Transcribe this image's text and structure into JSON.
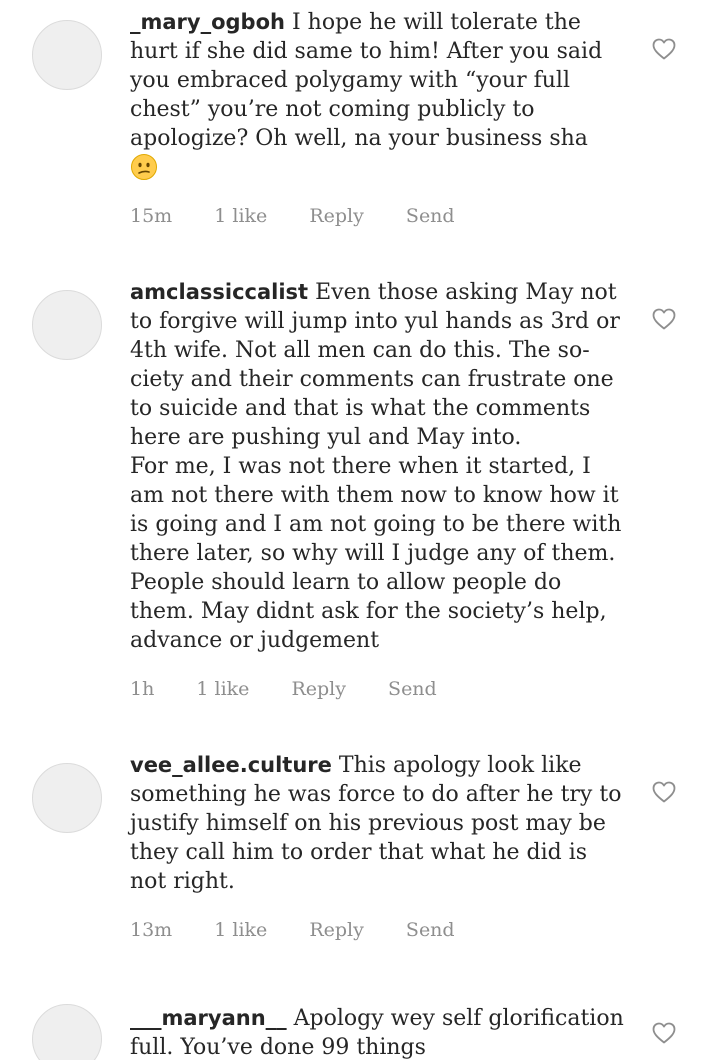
{
  "comments": [
    {
      "username": "_mary_ogboh",
      "text": "I hope he will tolerate the hurt if she did same to him! After you said you embraced polygamy with “your full chest” you’re not coming publicly to apologize? Oh well, na your business sha",
      "emoji": "confused-face-emoji",
      "time": "15m",
      "likes": "1 like",
      "reply_label": "Reply",
      "send_label": "Send"
    },
    {
      "username": "amclassiccalist",
      "text": "Even those asking May not to forgive will jump into yul hands as 3rd or 4th wife. Not all men can do this. The so-ciety and their comments can frustrate one to suicide and that is what the comments here are pushing yul and May into.",
      "text2": "For me, I was not there when it started, I am not there with them now to know how it is going and I am not going to be there with there later, so why will I judge any of them. People should learn to allow people do them. May didnt ask for the society’s help, advance or judgement",
      "time": "1h",
      "likes": "1 like",
      "reply_label": "Reply",
      "send_label": "Send"
    },
    {
      "username": "vee_allee.culture",
      "text": "This apology look like something he was force to do after he try to justify himself on his previous post may be they call him to order that what he did is not right.",
      "time": "13m",
      "likes": "1 like",
      "reply_label": "Reply",
      "send_label": "Send"
    },
    {
      "username": "___maryann__",
      "text": "Apology wey self glorification full. You’ve done 99 things"
    }
  ],
  "icons": {
    "like": "heart-outline-icon"
  },
  "colors": {
    "avatar": "#efefef",
    "meta": "#8e8e8e",
    "text": "#262626"
  }
}
